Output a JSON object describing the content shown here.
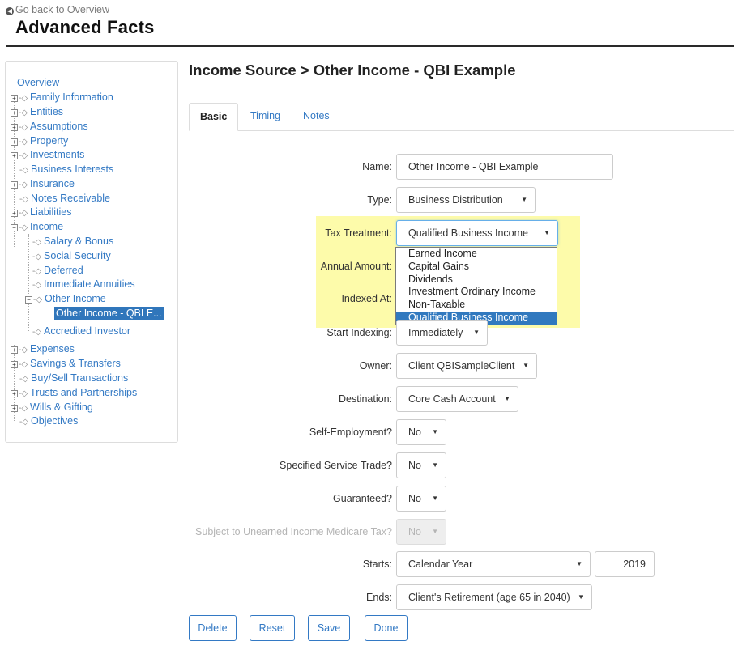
{
  "header": {
    "back_link": "Go back to Overview",
    "title": "Advanced Facts"
  },
  "sidebar": {
    "overview": "Overview",
    "items": {
      "family_information": "Family Information",
      "entities": "Entities",
      "assumptions": "Assumptions",
      "property": "Property",
      "investments": "Investments",
      "business_interests": "Business Interests",
      "insurance": "Insurance",
      "notes_receivable": "Notes Receivable",
      "liabilities": "Liabilities",
      "income": "Income",
      "salary_bonus": "Salary & Bonus",
      "social_security": "Social Security",
      "deferred": "Deferred",
      "immediate_annuities": "Immediate Annuities",
      "other_income": "Other Income",
      "other_income_qbi": "Other Income - QBI E...",
      "accredited_investor": "Accredited Investor",
      "expenses": "Expenses",
      "savings_transfers": "Savings & Transfers",
      "buy_sell": "Buy/Sell Transactions",
      "trusts": "Trusts and Partnerships",
      "wills": "Wills & Gifting",
      "objectives": "Objectives"
    }
  },
  "main": {
    "section_title": "Income Source > Other Income - QBI Example",
    "tabs": {
      "basic": "Basic",
      "timing": "Timing",
      "notes": "Notes"
    },
    "form": {
      "name_label": "Name:",
      "name_value": "Other Income - QBI Example",
      "type_label": "Type:",
      "type_value": "Business Distribution",
      "tax_label": "Tax Treatment:",
      "tax_value": "Qualified Business Income",
      "tax_options": [
        "Earned Income",
        "Capital Gains",
        "Dividends",
        "Investment Ordinary Income",
        "Non-Taxable",
        "Qualified Business Income"
      ],
      "annual_label": "Annual Amount:",
      "indexed_label": "Indexed At:",
      "start_indexing_label": "Start Indexing:",
      "start_indexing_value": "Immediately",
      "owner_label": "Owner:",
      "owner_value": "Client QBISampleClient",
      "destination_label": "Destination:",
      "destination_value": "Core Cash Account",
      "self_employment_label": "Self-Employment?",
      "self_employment_value": "No",
      "specified_service_label": "Specified Service Trade?",
      "specified_service_value": "No",
      "guaranteed_label": "Guaranteed?",
      "guaranteed_value": "No",
      "medicare_label": "Subject to Unearned Income Medicare Tax?",
      "medicare_value": "No",
      "starts_label": "Starts:",
      "starts_value": "Calendar Year",
      "starts_year": "2019",
      "ends_label": "Ends:",
      "ends_value": "Client's Retirement (age 65 in 2040)"
    },
    "buttons": {
      "delete": "Delete",
      "reset": "Reset",
      "save": "Save",
      "done": "Done"
    }
  },
  "colors": {
    "link": "#3379c4",
    "highlight": "#fdfbaa",
    "selected": "#3179bf"
  }
}
